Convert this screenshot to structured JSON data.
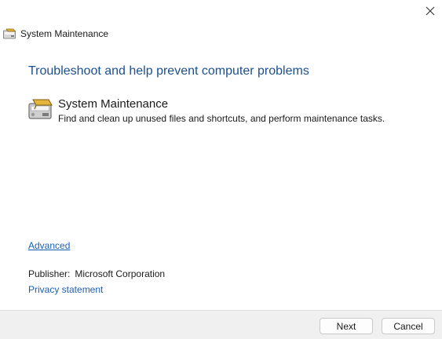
{
  "window": {
    "title": "System Maintenance",
    "close_icon": "close-icon",
    "title_icon": "maintenance-icon"
  },
  "main": {
    "heading": "Troubleshoot and help prevent computer problems",
    "task": {
      "icon": "maintenance-tools-icon",
      "title": "System Maintenance",
      "description": "Find and clean up unused files and shortcuts, and perform maintenance tasks."
    },
    "advanced_link": "Advanced",
    "publisher_label": "Publisher:",
    "publisher_value": "Microsoft Corporation",
    "privacy_link": "Privacy statement"
  },
  "footer": {
    "next_label": "Next",
    "cancel_label": "Cancel"
  },
  "colors": {
    "heading": "#1c4f8f",
    "link": "#1a5fb4",
    "footer_bg": "#f0f0f0"
  }
}
